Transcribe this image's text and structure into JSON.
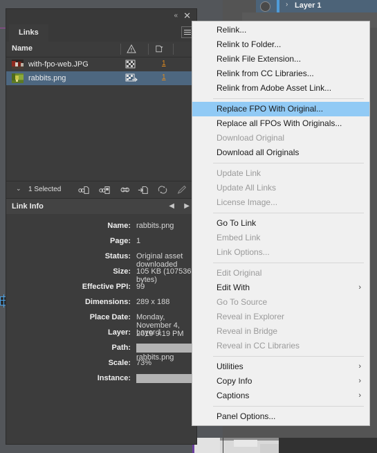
{
  "background": {
    "layer_label": "Layer 1",
    "layer_expand_arrow": "›"
  },
  "panel": {
    "title_tab": "Links",
    "collapse_icon": "«",
    "close_icon": "✕",
    "menu_icon": "hamburger-icon",
    "columns": {
      "name": "Name",
      "status_icon": "warning-triangle-icon",
      "page_icon": "page-icon"
    },
    "rows": [
      {
        "name": "with-fpo-web.JPG",
        "page": "1",
        "selected": false,
        "status_icon": "fpo-checker-icon",
        "thumb": "with-fpo-web-thumb"
      },
      {
        "name": "rabbits.png",
        "page": "1",
        "selected": true,
        "status_icon": "fpo-checker-link-icon",
        "thumb": "rabbits-thumb"
      }
    ],
    "toolbar": {
      "chevron": "⌄",
      "selected_text": "1 Selected",
      "buttons": [
        "relink-icon",
        "relink-to-folder-icon",
        "go-to-link-icon",
        "update-link-icon",
        "refresh-icon",
        "edit-original-icon"
      ]
    },
    "link_info": {
      "heading": "Link Info",
      "prev_arrow": "◀",
      "next_arrow": "▶",
      "fields": [
        {
          "label": "Name:",
          "value": "rabbits.png",
          "redacted": false
        },
        {
          "label": "Page:",
          "value": "1",
          "redacted": false
        },
        {
          "label": "Status:",
          "value": "Original asset downloaded",
          "redacted": false
        },
        {
          "label": "Size:",
          "value": "105 KB (107536 bytes)",
          "redacted": false
        },
        {
          "label": "Effective PPI:",
          "value": "99",
          "redacted": false
        },
        {
          "label": "Dimensions:",
          "value": "289 x 188",
          "redacted": false
        },
        {
          "label": "Place Date:",
          "value": "Monday, November 4, 2019 9:19 PM",
          "redacted": false
        },
        {
          "label": "Layer:",
          "value": "Layer 1",
          "redacted": false
        },
        {
          "label": "Path:",
          "value": "rabbits.png",
          "redacted": true,
          "redact_width": 113
        },
        {
          "label": "Scale:",
          "value": "73%",
          "redacted": false
        },
        {
          "label": "Instance:",
          "value": "",
          "redacted": true,
          "redact_width": 147
        }
      ]
    }
  },
  "context_menu": {
    "items": [
      {
        "label": "Relink...",
        "state": "normal"
      },
      {
        "label": "Relink to Folder...",
        "state": "normal"
      },
      {
        "label": "Relink File Extension...",
        "state": "normal"
      },
      {
        "label": "Relink from CC Libraries...",
        "state": "normal"
      },
      {
        "label": "Relink from Adobe Asset Link...",
        "state": "normal"
      },
      {
        "separator": true
      },
      {
        "label": "Replace FPO With Original...",
        "state": "highlighted"
      },
      {
        "label": "Replace all FPOs With Originals...",
        "state": "normal"
      },
      {
        "label": "Download Original",
        "state": "disabled"
      },
      {
        "label": "Download all Originals",
        "state": "normal"
      },
      {
        "separator": true
      },
      {
        "label": "Update Link",
        "state": "disabled"
      },
      {
        "label": "Update All Links",
        "state": "disabled"
      },
      {
        "label": "License Image...",
        "state": "disabled"
      },
      {
        "separator": true
      },
      {
        "label": "Go To Link",
        "state": "normal"
      },
      {
        "label": "Embed Link",
        "state": "disabled"
      },
      {
        "label": "Link Options...",
        "state": "disabled"
      },
      {
        "separator": true
      },
      {
        "label": "Edit Original",
        "state": "disabled"
      },
      {
        "label": "Edit With",
        "state": "normal",
        "submenu": "›"
      },
      {
        "label": "Go To Source",
        "state": "disabled"
      },
      {
        "label": "Reveal in Explorer",
        "state": "disabled"
      },
      {
        "label": "Reveal in Bridge",
        "state": "disabled"
      },
      {
        "label": "Reveal in CC Libraries",
        "state": "disabled"
      },
      {
        "separator": true
      },
      {
        "label": "Utilities",
        "state": "normal",
        "submenu": "›"
      },
      {
        "label": "Copy Info",
        "state": "normal",
        "submenu": "›"
      },
      {
        "label": "Captions",
        "state": "normal",
        "submenu": "›"
      },
      {
        "separator": true
      },
      {
        "label": "Panel Options...",
        "state": "normal"
      }
    ]
  },
  "colors": {
    "panel_bg": "#3c3c3c",
    "selection_blue": "#4d6780",
    "menu_highlight": "#91caf5",
    "page_link_orange": "#e08b1e",
    "layer_strip_blue": "#4c6378",
    "guide_magenta": "#a246a2"
  }
}
